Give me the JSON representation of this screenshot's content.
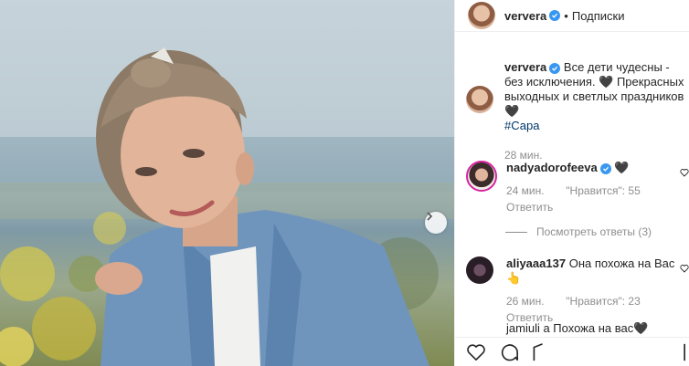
{
  "post": {
    "author": "ververa",
    "follow_state": "Подписки",
    "separator": "•",
    "next_glyph": "›"
  },
  "caption": {
    "author": "ververa",
    "text": "Все дети чудесны - без исключения. 🖤 Прекрасных выходных и светлых праздников 🖤",
    "hashtag": "#Сара",
    "time": "28 мин."
  },
  "comments": [
    {
      "user": "nadyadorofeeva",
      "text": "🖤",
      "time": "24 мин.",
      "likes": "\"Нравится\": 55",
      "reply": "Ответить"
    },
    {
      "user": "aliyaaa137",
      "text": "Она похожа на Вас👆",
      "time": "26 мин.",
      "likes": "\"Нравится\": 23",
      "reply": "Ответить"
    },
    {
      "user": "jamiuli",
      "text": "а Похожа на вас🖤"
    }
  ],
  "view_replies": "Посмотреть ответы (3)",
  "colors": {
    "verified": "#3897f0",
    "hashtag": "#003569",
    "meta": "#8e8e8e"
  },
  "icons": [
    "heart-icon",
    "comment-icon",
    "share-icon",
    "bookmark-icon",
    "chevron-right-icon",
    "verified-icon"
  ]
}
